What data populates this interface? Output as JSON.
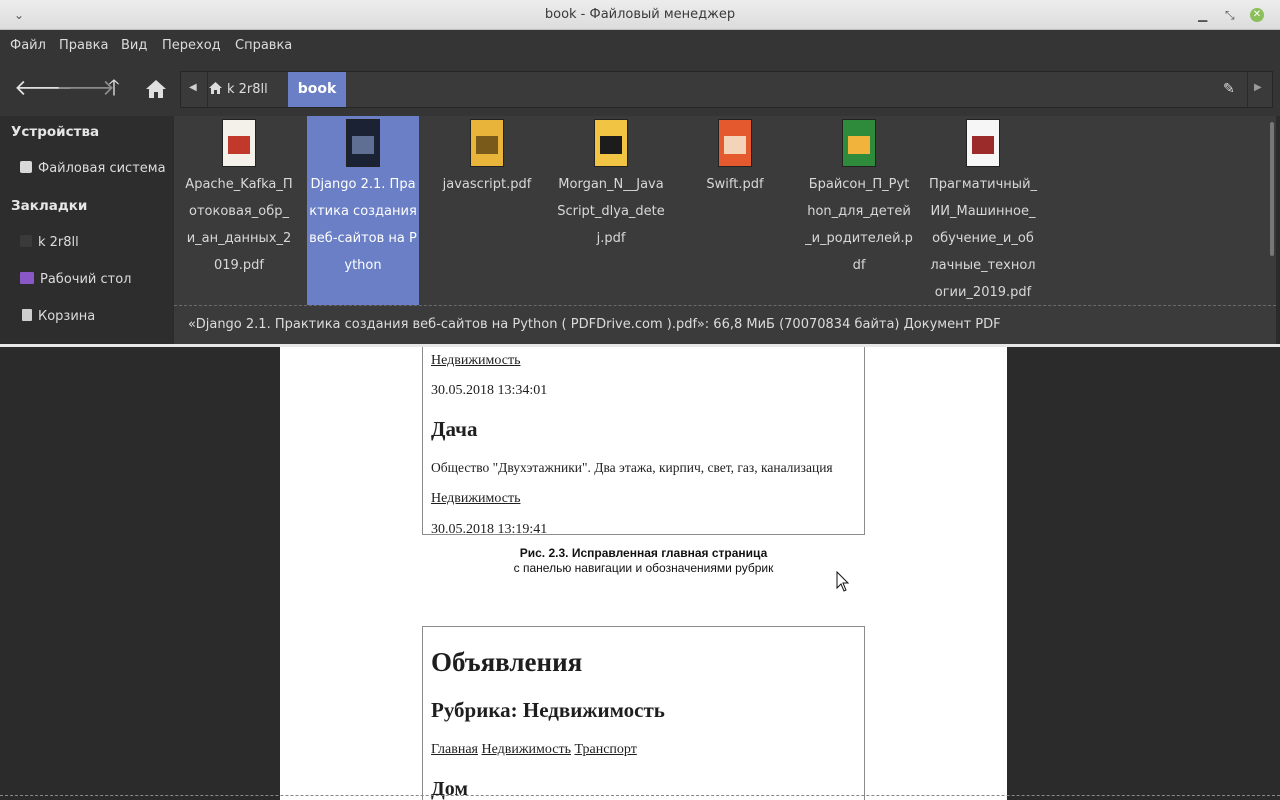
{
  "window": {
    "title": "book - Файловый менеджер"
  },
  "menu": [
    "Файл",
    "Правка",
    "Вид",
    "Переход",
    "Справка"
  ],
  "toolbar": {
    "crumb_home": "k 2r8ll",
    "crumb_current": "book"
  },
  "sidebar": {
    "devices_header": "Устройства",
    "filesystem": "Файловая система",
    "bookmarks_header": "Закладки",
    "home": "k 2r8ll",
    "desktop": "Рабочий стол",
    "trash": "Корзина"
  },
  "files": [
    {
      "name": "Apache_Kafka_Потоковая_обр_и_ан_данных_2019.pdf",
      "cover": "#f4f1ea",
      "accent": "#c0392b"
    },
    {
      "name": "Django 2.1. Практика создания веб-сайтов на Python",
      "cover": "#1b2233",
      "accent": "#5f6f94",
      "selected": true
    },
    {
      "name": "javascript.pdf",
      "cover": "#e8b53a",
      "accent": "#7a5a1a"
    },
    {
      "name": "Morgan_N__JavaScript_dlya_detej.pdf",
      "cover": "#f2c443",
      "accent": "#1c1c1c"
    },
    {
      "name": "Swift.pdf",
      "cover": "#e45a2e",
      "accent": "#f4d4b8"
    },
    {
      "name": "Брайсон_П_Python_для_детей_и_родителей.pdf",
      "cover": "#2f8b3c",
      "accent": "#f2b33d"
    },
    {
      "name": "Прагматичный_ИИ_Машинное_обучение_и_облачные_технологии_2019.pdf",
      "cover": "#f6f6f6",
      "accent": "#9b2b2b"
    }
  ],
  "status": "«Django 2.1. Практика создания веб-сайтов на Python ( PDFDrive.com ).pdf»: 66,8 МиБ (70070834 байта) Документ PDF",
  "preview": {
    "box1": {
      "link1": "Недвижимость",
      "date1": "30.05.2018 13:34:01",
      "heading": "Дача",
      "text": "Общество \"Двухэтажники\". Два этажа, кирпич, свет, газ, канализация",
      "link2": "Недвижимость",
      "date2": "30.05.2018 13:19:41"
    },
    "caption_line1": "Рис. 2.3. Исправленная главная страница",
    "caption_line2": "с панелью навигации и обозначениями рубрик",
    "box2": {
      "title": "Объявления",
      "subtitle": "Рубрика: Недвижимость",
      "nav": [
        "Главная",
        "Недвижимость",
        "Транспорт"
      ],
      "item": "Дом"
    }
  }
}
